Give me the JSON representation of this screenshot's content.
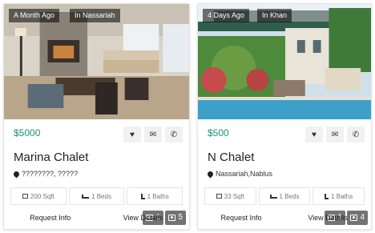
{
  "listings": [
    {
      "age_tag": "A Month Ago",
      "area_tag": "In Nassariah",
      "gallery_count": "1",
      "photo_count": "5",
      "price": "$5000",
      "title": "Marina Chalet",
      "location": "????????, ?????",
      "area": "200 Sqft",
      "beds": "1 Beds",
      "baths": "1 Baths",
      "request_label": "Request Info",
      "details_label": "View Details"
    },
    {
      "age_tag": "4 Days Ago",
      "area_tag": "In Khan",
      "gallery_count": "1",
      "photo_count": "4",
      "price": "$500",
      "title": "N Chalet",
      "location": "Nassariah,Nablus",
      "area": "33 Sqft",
      "beds": "1 Beds",
      "baths": "1 Baths",
      "request_label": "Request Info",
      "details_label": "View Details"
    }
  ],
  "icons": {
    "favorite": "heart-icon",
    "message": "envelope-icon",
    "call": "phone-icon",
    "location": "map-pin-icon",
    "area": "area-icon",
    "beds": "bed-icon",
    "baths": "bath-icon",
    "gallery": "gallery-icon",
    "photos": "camera-icon"
  },
  "colors": {
    "price": "#1f8f78"
  }
}
